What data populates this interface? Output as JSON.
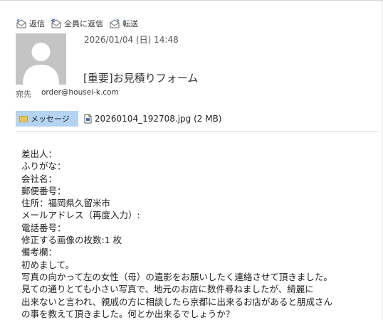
{
  "toolbar": {
    "reply": "返信",
    "reply_all": "全員に返信",
    "forward": "転送"
  },
  "header": {
    "date": "2026/01/04 (日) 14:48",
    "subject": "[重要]お見積りフォーム",
    "to_label": "宛先",
    "to_value": "order@housei-k.com"
  },
  "tabs": {
    "message": "メッセージ",
    "attachment": "20260104_192708.jpg (2 MB)"
  },
  "body": {
    "lines": [
      "差出人：",
      "ふりがな：",
      "会社名：",
      "郵便番号：",
      "住所：福岡県久留米市",
      "メールアドレス（再度入力）:",
      "電話番号：",
      "修正する画像の枚数:1 枚",
      "備考欄：",
      "初めまして。",
      "写真の向かって左の女性（母）の遺影をお願いしたく連絡させて頂きました。",
      "見ての通りとても小さい写真で、地元のお店に数件尋ねましたが、綺麗に",
      "出来ないと言われ、親戚の方に相談したら京都に出来るお店があると朋成さん",
      "の事を教えて頂きました。何とか出来るでしょうか？"
    ]
  },
  "colors": {
    "tab_active": "#b3d4f2",
    "avatar_bg": "#c4c4c4"
  },
  "icons": {
    "reply": "reply-envelope-icon",
    "reply_all": "reply-all-envelope-icon",
    "forward": "forward-envelope-icon",
    "avatar": "user-silhouette-icon",
    "attachment": "file-icon"
  }
}
